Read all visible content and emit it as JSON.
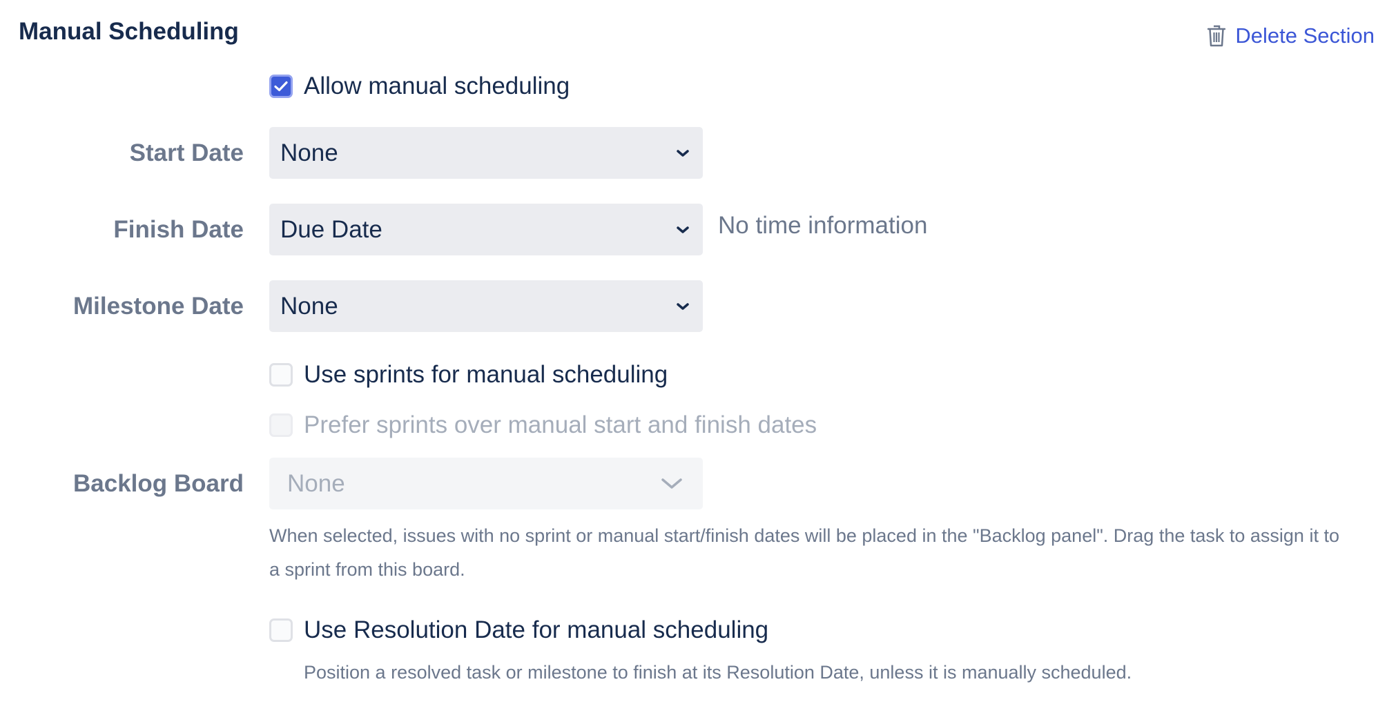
{
  "section": {
    "title": "Manual Scheduling",
    "delete_label": "Delete Section"
  },
  "allow_manual": {
    "label": "Allow manual scheduling",
    "checked": true
  },
  "start_date": {
    "label": "Start Date",
    "value": "None"
  },
  "finish_date": {
    "label": "Finish Date",
    "value": "Due Date",
    "note": "No time information"
  },
  "milestone_date": {
    "label": "Milestone Date",
    "value": "None"
  },
  "use_sprints": {
    "label": "Use sprints for manual scheduling",
    "checked": false
  },
  "prefer_sprints": {
    "label": "Prefer sprints over manual start and finish dates",
    "checked": false,
    "disabled": true
  },
  "backlog_board": {
    "label": "Backlog Board",
    "value": "None",
    "disabled": true,
    "help_line1": "When selected, issues with no sprint or manual start/finish dates will be placed in the \"Backlog panel\". Drag the task to assign it to",
    "help_line2": "a sprint from this board."
  },
  "resolution_date": {
    "label": "Use Resolution Date for manual scheduling",
    "checked": false,
    "help": "Position a resolved task or milestone to finish at its Resolution Date, unless it is manually scheduled."
  },
  "colors": {
    "accent": "#3d5bd8",
    "link": "#3b56d6",
    "title": "#172b4d",
    "label": "#6b778c",
    "field_bg": "#ebecf0"
  },
  "icons": {
    "delete": "trash-icon",
    "dropdown": "chevron-down-icon",
    "check": "checkmark-icon"
  }
}
